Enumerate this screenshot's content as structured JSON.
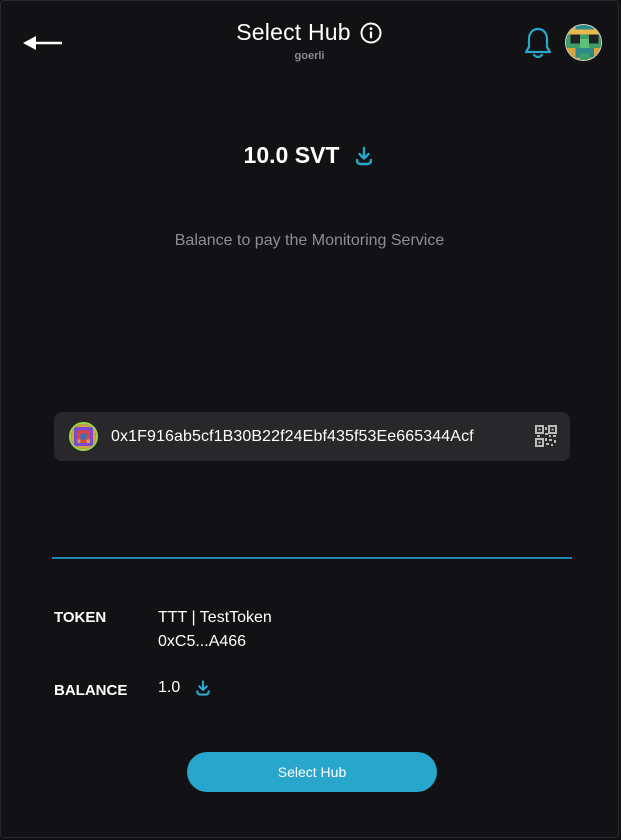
{
  "header": {
    "title": "Select Hub",
    "network": "goerli",
    "back_icon": "arrow-left-icon",
    "info_icon": "info-circle-icon",
    "bell_icon": "bell-icon"
  },
  "balance": {
    "amount": "10.0 SVT",
    "caption": "Balance to pay the Monitoring Service",
    "download_icon": "download-icon"
  },
  "address": {
    "value": "0x1F916ab5cf1B30B22f24Ebf435f53Ee665344Acf",
    "qr_icon": "qr-code-icon"
  },
  "details": {
    "token_label": "TOKEN",
    "token_name": "TTT | TestToken",
    "token_address": "0xC5...A466",
    "balance_label": "BALANCE",
    "balance_value": "1.0"
  },
  "actions": {
    "select_hub_label": "Select Hub"
  },
  "colors": {
    "background": "#121214",
    "accent": "#29a6cb",
    "panel": "#28282b",
    "muted_text": "#8f8f93"
  }
}
